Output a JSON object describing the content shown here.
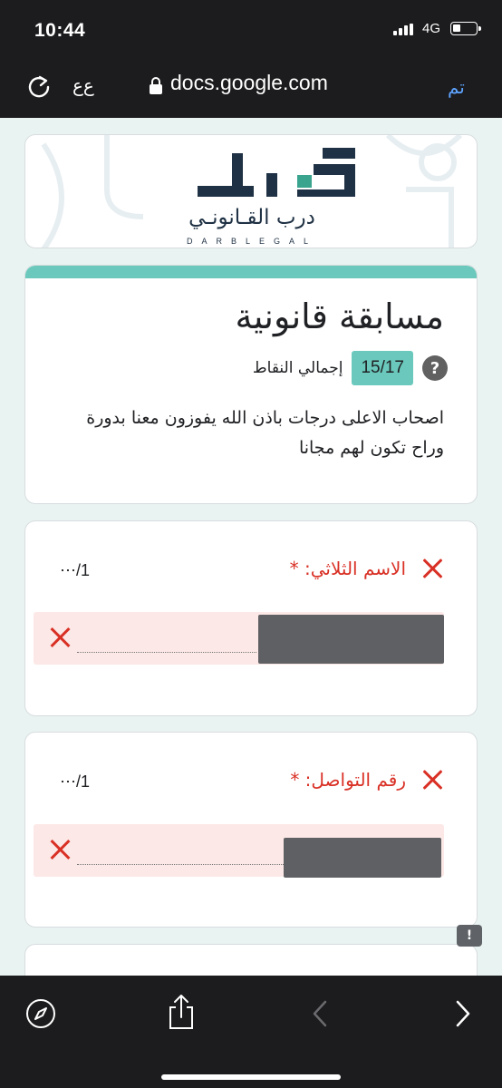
{
  "status": {
    "time": "10:44",
    "network": "4G"
  },
  "browser": {
    "text_size": "ﻉﻉ",
    "domain": "docs.google.com",
    "done": "تم"
  },
  "logo": {
    "arabic": "درب القـانونـي",
    "english": "DARBLEGAL"
  },
  "form": {
    "title": "مسابقة قانونية",
    "score_label": "إجمالي النقاط",
    "score": "15/17",
    "help_icon": "?",
    "description": "اصحاب الاعلى درجات باذن الله يفوزون معنا بدورة وراح تكون لهم مجانا"
  },
  "questions": [
    {
      "label": "الاسم الثلاثي: *",
      "points": "⋯/1",
      "status": "incorrect",
      "answer_hidden": true
    },
    {
      "label": "رقم التواصل: *",
      "points": "⋯/1",
      "status": "incorrect",
      "answer_hidden": true
    }
  ],
  "feedback_icon": "!",
  "colors": {
    "accent": "#6ac9bc",
    "error": "#d93025",
    "error_bg": "#fce8e6",
    "chrome": "#1c1c1e",
    "link": "#5ea3ff"
  },
  "icons": [
    "reload-icon",
    "lock-icon",
    "compass-icon",
    "share-icon",
    "back-icon",
    "forward-icon"
  ]
}
